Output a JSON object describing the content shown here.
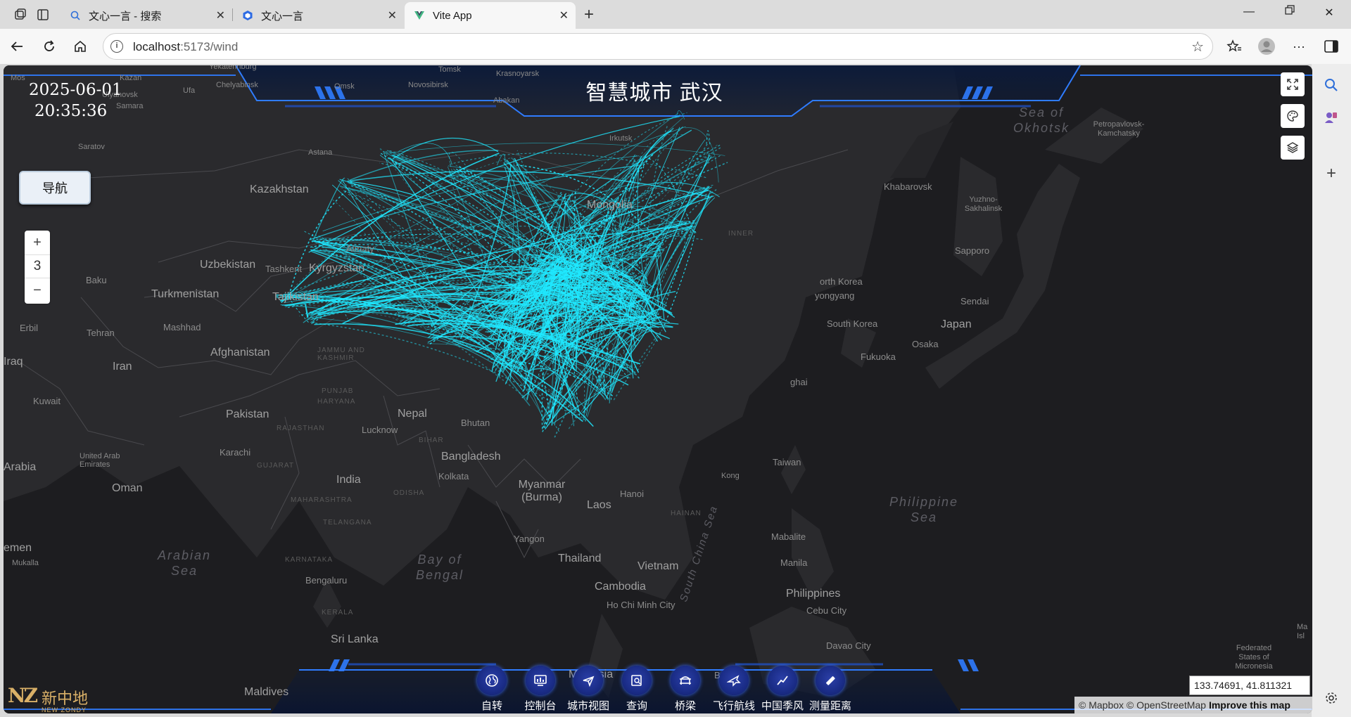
{
  "browser": {
    "tabs": [
      {
        "title": "文心一言 - 搜索",
        "icon": "search-icon",
        "active": false
      },
      {
        "title": "文心一言",
        "icon": "wenxin-icon",
        "active": false
      },
      {
        "title": "Vite App",
        "icon": "vite-icon",
        "active": true
      }
    ],
    "url_host": "localhost",
    "url_path": ":5173/wind"
  },
  "app": {
    "title": "智慧城市 武汉",
    "date": "2025-06-01",
    "time": "20:35:36",
    "nav_button": "导航",
    "zoom_level": "3",
    "coordinates": "133.74691, 41.811321",
    "attribution": "© Mapbox © OpenStreetMap",
    "attribution_link": "Improve this map",
    "logo_text": "新中地",
    "logo_sub": "NEW ZONDY",
    "logo_mark": "NZ",
    "bottom_nav": [
      "自转",
      "控制台",
      "城市视图",
      "查询",
      "桥梁",
      "飞行航线",
      "中国季风",
      "测量距离"
    ],
    "accent_color": "#1fe8ff"
  },
  "map_labels": {
    "moscow": "Mos",
    "kazan": "Kazan",
    "yekaterinburg": "Yekaterinburg",
    "ufa": "Ufa",
    "chelyabinsk": "Chelyabinsk",
    "ulyanovsk": "Ulyanovsk",
    "samara": "Samara",
    "saratov": "Saratov",
    "tomsk": "Tomsk",
    "omsk": "Omsk",
    "novosibirsk": "Novosibirsk",
    "krasnoyarsk": "Krasnoyarsk",
    "abakan": "Abakan",
    "irkutsk": "Irkutsk",
    "astana": "Astana",
    "kazakhstan": "Kazakhstan",
    "mongolia": "Mongolia",
    "almaty": "Almaty",
    "uzbekistan": "Uzbekistan",
    "tashkent": "Tashkent",
    "kyrgyzstan": "Kyrgyzstan",
    "baku": "Baku",
    "turkmenistan": "Turkmenistan",
    "tajikistan": "Tajikistan",
    "erbil": "Erbil",
    "tehran": "Tehran",
    "mashhad": "Mashhad",
    "afghanistan": "Afghanistan",
    "iraq": "Iraq",
    "iran": "Iran",
    "kuwait": "Kuwait",
    "pakistan": "Pakistan",
    "nepal": "Nepal",
    "bhutan": "Bhutan",
    "lucknow": "Lucknow",
    "karachi": "Karachi",
    "rajasthan": "RAJASTHAN",
    "bihar": "BIHAR",
    "jammu": "JAMMU AND KASHMIR",
    "punjab": "PUNJAB",
    "haryana": "HARYANA",
    "gujarat": "GUJARAT",
    "bangladesh": "Bangladesh",
    "kolkata": "Kolkata",
    "india": "India",
    "uae": "United Arab Emirates",
    "arabia": "Arabia",
    "oman": "Oman",
    "maharashtra": "MAHARASHTRA",
    "odisha": "ODISHA",
    "telangana": "TELANGANA",
    "karnataka": "KARNATAKA",
    "kerala": "KERALA",
    "bengaluru": "Bengaluru",
    "yemen": "emen",
    "mukalla": "Mukalla",
    "arabian_sea": "Arabian Sea",
    "bay_of_bengal": "Bay of Bengal",
    "sri_lanka": "Sri Lanka",
    "maldives": "Maldives",
    "myanmar": "Myanmar (Burma)",
    "yangon": "Yangon",
    "thailand": "Thailand",
    "laos": "Laos",
    "hanoi": "Hanoi",
    "vietnam": "Vietnam",
    "cambodia": "Cambodia",
    "hcmc": "Ho Chi Minh City",
    "south_china_sea": "South China Sea",
    "malaysia": "Malaysia",
    "taiwan": "Taiwan",
    "hong_kong": "Kong",
    "hainan": "HAINAN",
    "philippine_sea": "Philippine Sea",
    "mabalite": "Mabalite",
    "manila": "Manila",
    "philippines": "Philippines",
    "cebu": "Cebu City",
    "davao": "Davao City",
    "micronesia": "Federated States of Micronesia",
    "ma": "Ma Isl",
    "sea_okhotsk": "Sea of Okhotsk",
    "petropavlovsk": "Petropavlovsk-Kamchatsky",
    "khabarovsk": "Khabarovsk",
    "yuzhno": "Yuzhno-Sakhalinsk",
    "sapporo": "Sapporo",
    "sendai": "Sendai",
    "japan": "Japan",
    "osaka": "Osaka",
    "fukuoka": "Fukuoka",
    "south_korea": "South Korea",
    "north_korea": "orth Korea",
    "pyongyang": "yongyang",
    "inner": "INNER",
    "shanghai": "ghai",
    "bei": "Be"
  }
}
